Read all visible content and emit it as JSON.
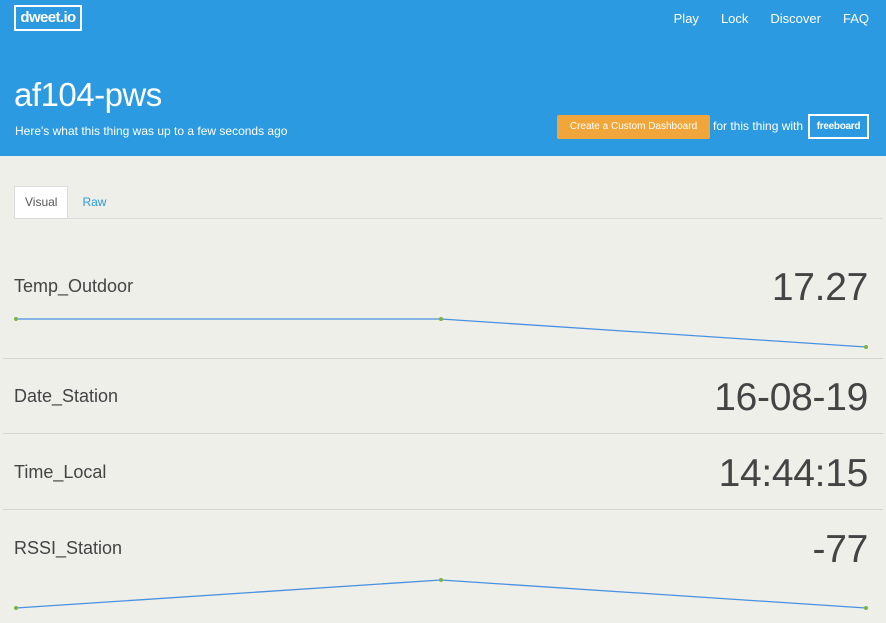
{
  "header": {
    "logo": "dweet.io",
    "nav": [
      "Play",
      "Lock",
      "Discover",
      "FAQ"
    ],
    "title": "af104-pws",
    "subtitle": "Here's what this thing was up to a few seconds ago",
    "dashboard_button": "Create a Custom Dashboard",
    "for_text": "for this thing with",
    "freeboard_button": "freeboard",
    "background_color": "#2b9ae0",
    "button_color": "#f0a63a"
  },
  "tabs": [
    "Visual",
    "Raw"
  ],
  "rows": [
    {
      "label": "Temp_Outdoor",
      "value": "17.27",
      "spark": [
        17.28,
        17.28,
        17.27
      ]
    },
    {
      "label": "Date_Station",
      "value": "16-08-19"
    },
    {
      "label": "Time_Local",
      "value": "14:44:15"
    },
    {
      "label": "RSSI_Station",
      "value": "-77",
      "spark": [
        -77,
        -76,
        -77
      ]
    }
  ],
  "colors": {
    "sparkline": "#4a90e2",
    "sparkpoint": "#7cb342"
  }
}
